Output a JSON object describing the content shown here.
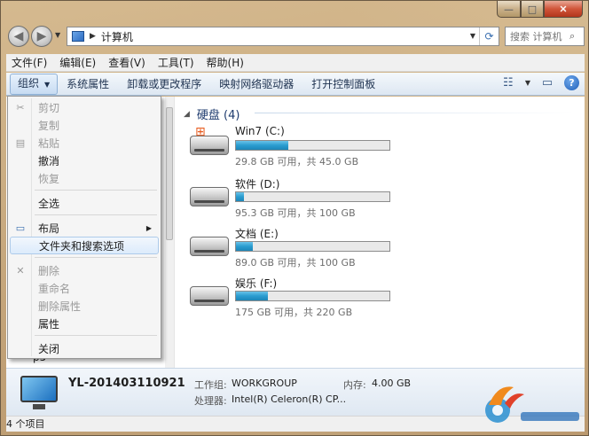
{
  "window": {
    "caption": {
      "minimize": "—",
      "maximize": "□",
      "close": "✕"
    }
  },
  "address": {
    "crumb": "计算机",
    "search_placeholder": "搜索 计算机"
  },
  "menubar": [
    "文件(F)",
    "编辑(E)",
    "查看(V)",
    "工具(T)",
    "帮助(H)"
  ],
  "toolbar": {
    "organize": "组织",
    "items": [
      "系统属性",
      "卸载或更改程序",
      "映射网络驱动器",
      "打开控制面板"
    ]
  },
  "group": {
    "header": "硬盘 (4)"
  },
  "drives": [
    {
      "name": "Win7 (C:)",
      "size": "29.8 GB 可用，共 45.0 GB",
      "used_fraction": 0.34,
      "system": true
    },
    {
      "name": "软件 (D:)",
      "size": "95.3 GB 可用，共 100 GB",
      "used_fraction": 0.05,
      "system": false
    },
    {
      "name": "文档 (E:)",
      "size": "89.0 GB 可用，共 100 GB",
      "used_fraction": 0.11,
      "system": false
    },
    {
      "name": "娱乐 (F:)",
      "size": "175 GB 可用，共 220 GB",
      "used_fraction": 0.21,
      "system": false
    }
  ],
  "context_menu": {
    "cut": "剪切",
    "copy": "复制",
    "paste": "粘贴",
    "undo": "撤消",
    "redo": "恢复",
    "select_all": "全选",
    "layout": "布局",
    "folder_options": "文件夹和搜索选项",
    "delete": "删除",
    "rename": "重命名",
    "remove_props": "删除属性",
    "properties": "属性",
    "close": "关闭"
  },
  "navpane": {
    "peek": "p5"
  },
  "details": {
    "pc_name": "YL-201403110921",
    "workgroup_label": "工作组:",
    "workgroup_value": "WORKGROUP",
    "memory_label": "内存:",
    "memory_value": "4.00 GB",
    "cpu_label": "处理器:",
    "cpu_value": "Intel(R) Celeron(R) CP..."
  },
  "status": {
    "count": "4 个项目"
  },
  "colors": {
    "bar_fill": "#2a9cd0",
    "highlight_border": "#aecbea"
  }
}
